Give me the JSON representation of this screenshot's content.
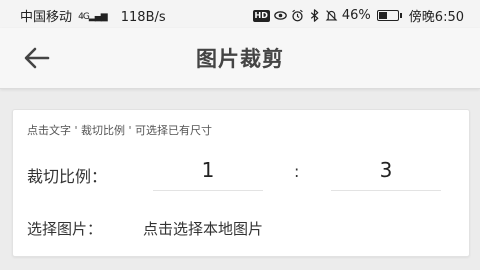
{
  "status_bar": {
    "carrier": "中国移动",
    "network": "4G",
    "speed": "118B/s",
    "hd_badge": "HD",
    "battery": "46%",
    "battery_level": 0.46,
    "time": "傍晚6:50",
    "icons": [
      "signal-icon",
      "hd-icon",
      "eye-icon",
      "alarm-icon",
      "bluetooth-icon",
      "mute-icon",
      "battery-icon"
    ]
  },
  "app_bar": {
    "back_icon": "arrow-left-icon",
    "title": "图片裁剪"
  },
  "form": {
    "hint": "点击文字 ' 裁切比例 ' 可选择已有尺寸",
    "ratio_label": "裁切比例：",
    "ratio_width": "1",
    "ratio_separator": ":",
    "ratio_height": "3",
    "pick_label": "选择图片：",
    "pick_action": "点击选择本地图片"
  }
}
